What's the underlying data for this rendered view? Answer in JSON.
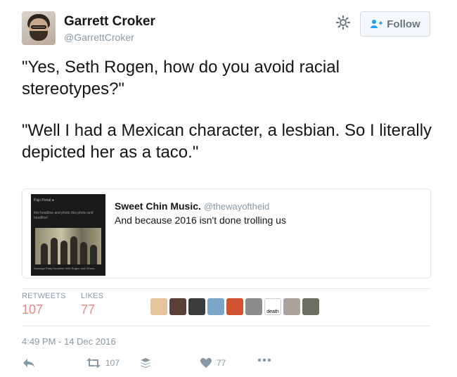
{
  "user": {
    "name": "Garrett Croker",
    "handle": "@GarrettCroker",
    "follow_label": "Follow"
  },
  "tweet": {
    "paragraphs": [
      "\"Yes, Seth Rogen, how do you avoid racial stereotypes?\"",
      "\"Well I had a Mexican character, a lesbian. So I literally depicted her as a taco.\""
    ]
  },
  "quote": {
    "name": "Sweet Chin Music.",
    "handle": "@thewayoftheid",
    "text": "And because 2016 isn't done trolling us",
    "thumbnail": {
      "header": "Pajo Portal ●",
      "caption": "this headline and photo this photo and headline!",
      "footer": "Sausage Party Headline Seth Rogen and Others..."
    }
  },
  "stats": {
    "retweets_label": "RETWEETS",
    "retweets": "107",
    "likes_label": "LIKES",
    "likes": "77"
  },
  "likers": [
    {
      "name": "liker-1",
      "color": "#e7c39a"
    },
    {
      "name": "liker-2",
      "color": "#5a4038"
    },
    {
      "name": "liker-3",
      "color": "#3b3b3b"
    },
    {
      "name": "liker-4",
      "color": "#7aa6c8"
    },
    {
      "name": "liker-5",
      "color": "#d0522e"
    },
    {
      "name": "liker-6",
      "color": "#8c8c8c"
    },
    {
      "name": "liker-7",
      "label": "death",
      "color": "#ffffff"
    },
    {
      "name": "liker-8",
      "color": "#a7a49c"
    },
    {
      "name": "liker-9",
      "color": "#6b6f63"
    }
  ],
  "timestamp": "4:49 PM - 14 Dec 2016",
  "actions": {
    "retweet_count": "107",
    "like_count": "77"
  },
  "colors": {
    "accent_like": "#e0245e",
    "muted": "#8899a6",
    "border": "#e1e8ed"
  }
}
